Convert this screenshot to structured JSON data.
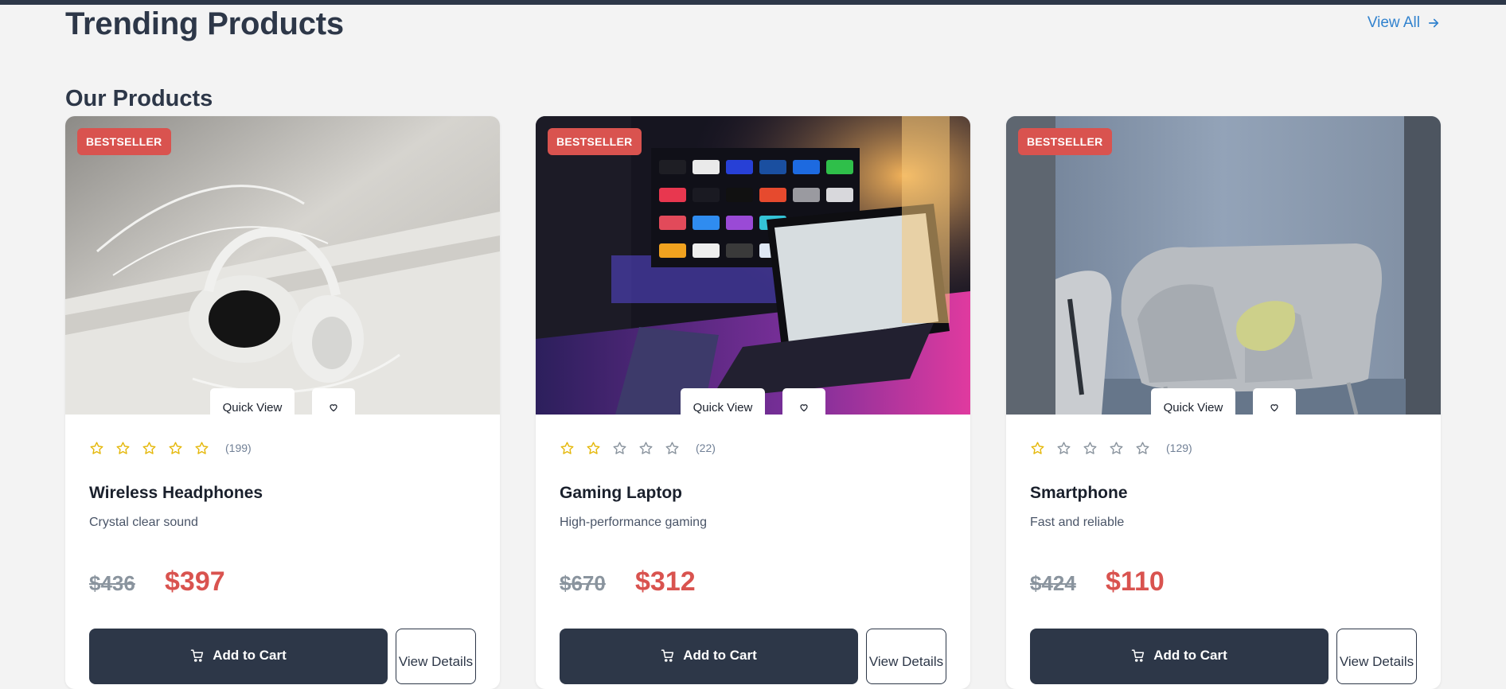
{
  "header": {
    "title": "Trending Products",
    "view_all_label": "View All",
    "view_all_icon": "arrow-right-icon",
    "accent_color": "#3182ce"
  },
  "section": {
    "title": "Our Products"
  },
  "colors": {
    "dark": "#2d3748",
    "sale": "#d9534f",
    "star": "#e5b80b",
    "page_bg": "#f3f3f3"
  },
  "products": [
    {
      "badge": "BESTSELLER",
      "image_subject": "white headphones on a notebook",
      "quick_view_label": "Quick View",
      "wishlist_icon": "heart-icon",
      "rating": 5,
      "max_rating": 5,
      "review_count": "(199)",
      "name": "Wireless Headphones",
      "description": "Crystal clear sound",
      "old_price": "$436",
      "price": "$397",
      "add_to_cart_label": "Add to Cart",
      "cart_icon": "cart-icon",
      "view_details_label": "View Details"
    },
    {
      "badge": "BESTSELLER",
      "image_subject": "tablet with keyboard in front of a TV",
      "quick_view_label": "Quick View",
      "wishlist_icon": "heart-icon",
      "rating": 2,
      "max_rating": 5,
      "review_count": "(22)",
      "name": "Gaming Laptop",
      "description": "High-performance gaming",
      "old_price": "$670",
      "price": "$312",
      "add_to_cart_label": "Add to Cart",
      "cart_icon": "cart-icon",
      "view_details_label": "View Details"
    },
    {
      "badge": "BESTSELLER",
      "image_subject": "grey armchair with yellow cushion",
      "quick_view_label": "Quick View",
      "wishlist_icon": "heart-icon",
      "rating": 1,
      "max_rating": 5,
      "review_count": "(129)",
      "name": "Smartphone",
      "description": "Fast and reliable",
      "old_price": "$424",
      "price": "$110",
      "add_to_cart_label": "Add to Cart",
      "cart_icon": "cart-icon",
      "view_details_label": "View Details"
    }
  ]
}
